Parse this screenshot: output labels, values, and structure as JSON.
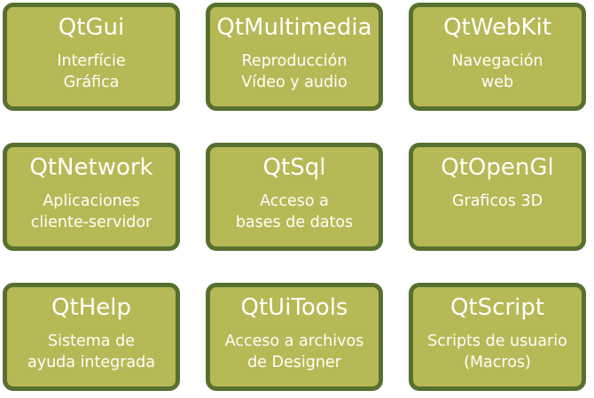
{
  "colors": {
    "box_fill": "#b6b955",
    "box_border": "#56702f",
    "text": "#ffffff"
  },
  "modules": [
    {
      "title": "QtGui",
      "description": "Interfície\nGráfica"
    },
    {
      "title": "QtMultimedia",
      "description": "Reproducción\nVídeo y audio"
    },
    {
      "title": "QtWebKit",
      "description": "Navegación\nweb"
    },
    {
      "title": "QtNetwork",
      "description": "Aplicaciones\ncliente-servidor"
    },
    {
      "title": "QtSql",
      "description": "Acceso a\nbases de datos"
    },
    {
      "title": "QtOpenGl",
      "description": "Graficos 3D"
    },
    {
      "title": "QtHelp",
      "description": "Sistema de\nayuda integrada"
    },
    {
      "title": "QtUiTools",
      "description": "Acceso a archivos\nde Designer"
    },
    {
      "title": "QtScript",
      "description": "Scripts de usuario\n(Macros)"
    }
  ]
}
